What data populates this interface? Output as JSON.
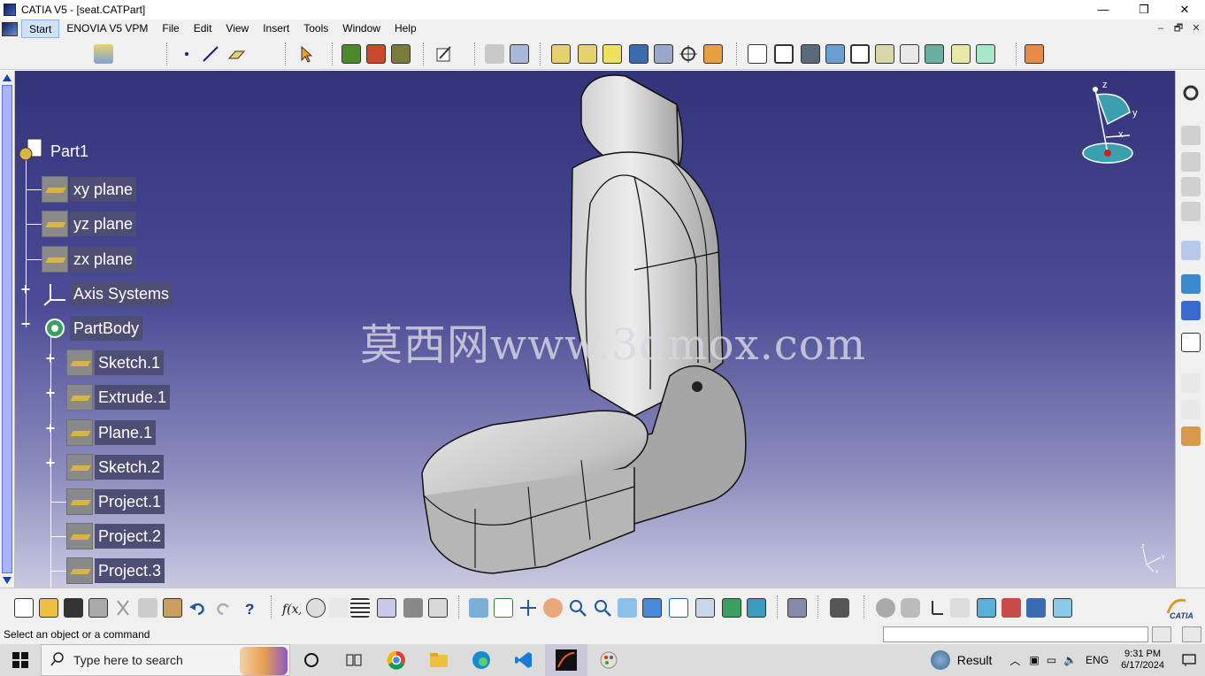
{
  "window": {
    "title": "CATIA V5 - [seat.CATPart]",
    "minimize": "—",
    "maximize": "❐",
    "close": "✕"
  },
  "menubar": {
    "items": [
      "Start",
      "ENOVIA V5 VPM",
      "File",
      "Edit",
      "View",
      "Insert",
      "Tools",
      "Window",
      "Help"
    ],
    "mdi": [
      "–",
      "🗗",
      "✕"
    ]
  },
  "tree": {
    "root": "Part1",
    "nodes": [
      {
        "label": "xy plane"
      },
      {
        "label": "yz plane"
      },
      {
        "label": "zx plane"
      },
      {
        "label": "Axis Systems"
      },
      {
        "label": "PartBody"
      },
      {
        "label": "Sketch.1"
      },
      {
        "label": "Extrude.1"
      },
      {
        "label": "Plane.1"
      },
      {
        "label": "Sketch.2"
      },
      {
        "label": "Project.1"
      },
      {
        "label": "Project.2"
      },
      {
        "label": "Project.3"
      }
    ]
  },
  "viewport": {
    "watermark": "莫西网www.3dmox.com",
    "compass": {
      "z": "z",
      "y": "y",
      "x": "x"
    }
  },
  "status": {
    "text": "Select an object or a command"
  },
  "taskbar": {
    "search_placeholder": "Type here to search",
    "weather": "Result",
    "lang": "ENG",
    "time": "9:31 PM",
    "date": "6/17/2024"
  },
  "colors": {
    "viewport_top": "#33337a",
    "viewport_bottom": "#c9c9e2",
    "tree_label_bg": "#4e4e74"
  }
}
